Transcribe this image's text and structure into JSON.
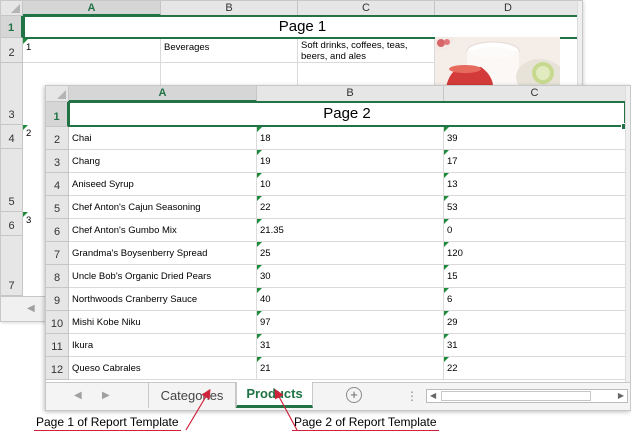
{
  "page1": {
    "columns": [
      "A",
      "B",
      "C",
      "D"
    ],
    "rows": [
      "1",
      "2",
      "3",
      "4",
      "5",
      "6",
      "7"
    ],
    "title": "Page 1",
    "record1": {
      "id": "1",
      "name": "Beverages",
      "description": "Soft drinks, coffees, teas, beers, and ales"
    },
    "id2": "2",
    "id3": "3"
  },
  "page2": {
    "columns": [
      "A",
      "B",
      "C"
    ],
    "rows": [
      "1",
      "2",
      "3",
      "4",
      "5",
      "6",
      "7",
      "8",
      "9",
      "10",
      "11",
      "12"
    ],
    "title": "Page 2",
    "products": [
      {
        "name": "Chai",
        "b": "18",
        "c": "39"
      },
      {
        "name": "Chang",
        "b": "19",
        "c": "17"
      },
      {
        "name": "Aniseed Syrup",
        "b": "10",
        "c": "13"
      },
      {
        "name": "Chef Anton's Cajun Seasoning",
        "b": "22",
        "c": "53"
      },
      {
        "name": "Chef Anton's Gumbo Mix",
        "b": "21.35",
        "c": "0"
      },
      {
        "name": "Grandma's Boysenberry Spread",
        "b": "25",
        "c": "120"
      },
      {
        "name": "Uncle Bob's Organic Dried Pears",
        "b": "30",
        "c": "15"
      },
      {
        "name": "Northwoods Cranberry Sauce",
        "b": "40",
        "c": "6"
      },
      {
        "name": "Mishi Kobe Niku",
        "b": "97",
        "c": "29"
      },
      {
        "name": "Ikura",
        "b": "31",
        "c": "31"
      },
      {
        "name": "Queso Cabrales",
        "b": "21",
        "c": "22"
      }
    ]
  },
  "tabs": [
    "Categories",
    "Products"
  ],
  "active_tab": "Products",
  "add_sheet_symbol": "+",
  "callouts": {
    "page1": "Page 1 of Report Template",
    "page2": "Page 2 of Report Template"
  },
  "colors": {
    "accent": "#217346",
    "callout_line": "#d0223a",
    "flag": "#1e8a3c"
  }
}
